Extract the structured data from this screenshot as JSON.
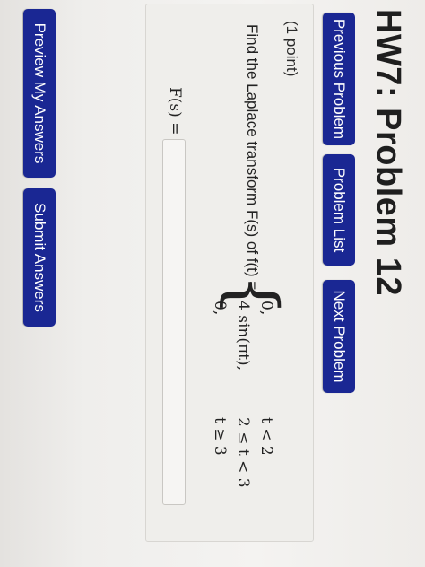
{
  "header": {
    "title": "HW7: Problem 12"
  },
  "nav": {
    "previous": "Previous Problem",
    "list": "Problem List",
    "next": "Next Problem"
  },
  "problem": {
    "points": "(1 point)",
    "question": "Find the Laplace transform F(s) of f(t) =",
    "cases": [
      {
        "value": "0,",
        "condition": "t < 2"
      },
      {
        "value": "4 sin(πt),",
        "condition": "2 ≤ t < 3"
      },
      {
        "value": "0,",
        "condition": "t ≥ 3"
      }
    ],
    "answer_label": "F(s) =",
    "answer_value": ""
  },
  "actions": {
    "preview": "Preview My Answers",
    "submit": "Submit Answers"
  },
  "colors": {
    "button_bg": "#1a2793",
    "button_text": "#ffffff"
  }
}
